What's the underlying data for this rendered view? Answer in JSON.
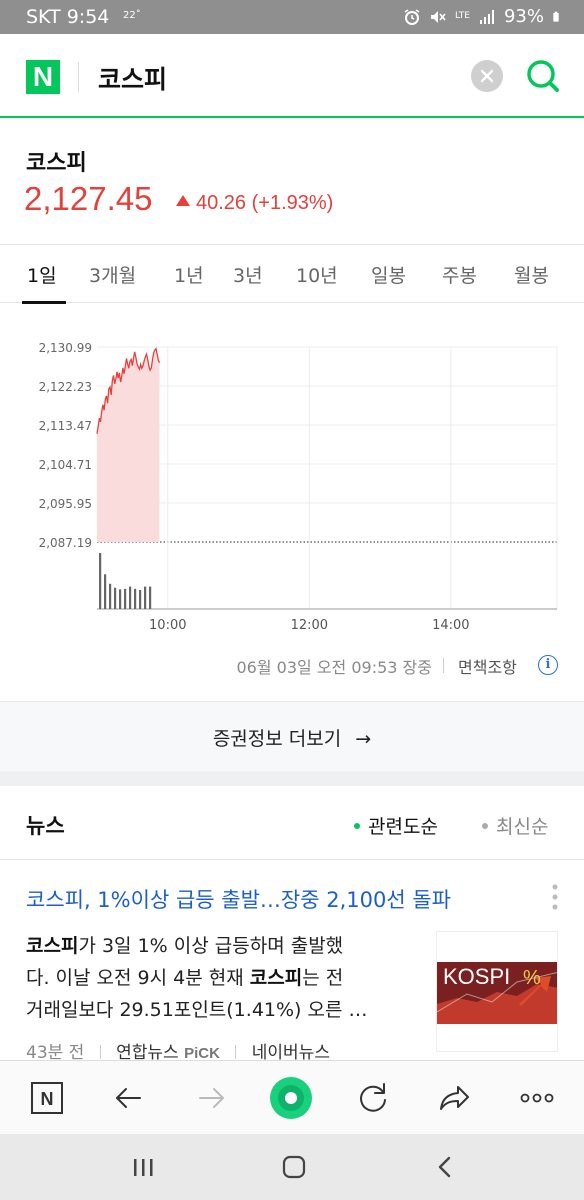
{
  "status_bar": {
    "carrier": "SKT",
    "time": "9:54",
    "temperature": "22˚",
    "network": "LTE",
    "battery": "93%"
  },
  "header": {
    "logo_letter": "N",
    "query": "코스피",
    "clear_icon": "close-icon",
    "search_icon": "search-icon",
    "accent_color": "#03c75a"
  },
  "stock": {
    "name": "코스피",
    "price": "2,127.45",
    "change": "40.26 (+1.93%)",
    "direction": "up",
    "up_color": "#e5413b"
  },
  "tabs": [
    {
      "label": "1일",
      "active": true
    },
    {
      "label": "3개월",
      "active": false
    },
    {
      "label": "1년",
      "active": false
    },
    {
      "label": "3년",
      "active": false
    },
    {
      "label": "10년",
      "active": false
    },
    {
      "label": "일봉",
      "active": false
    },
    {
      "label": "주봉",
      "active": false
    },
    {
      "label": "월봉",
      "active": false
    }
  ],
  "chart_data": {
    "type": "area",
    "y_ticks": [
      "2,130.99",
      "2,122.23",
      "2,113.47",
      "2,104.71",
      "2,095.95",
      "2,087.19"
    ],
    "ylim": [
      2087.19,
      2130.99
    ],
    "x_ticks": [
      "10:00",
      "12:00",
      "14:00"
    ],
    "x_range_minutes": [
      540,
      930
    ],
    "baseline": 2087.19,
    "series": [
      {
        "x": [
          540,
          541,
          542,
          543,
          544,
          545,
          546,
          547,
          548,
          549,
          550,
          551,
          552,
          553,
          554,
          555,
          556,
          557,
          558,
          559,
          560,
          561,
          562,
          563,
          564,
          565,
          566,
          567,
          568,
          569,
          570,
          571,
          572,
          573,
          574,
          575,
          576,
          577,
          578,
          579,
          580,
          581,
          582,
          583,
          584,
          585,
          586,
          587,
          588,
          589,
          590,
          591,
          592,
          593
        ],
        "values": [
          2111.5,
          2113.2,
          2115.0,
          2114.2,
          2116.5,
          2118.0,
          2116.8,
          2119.2,
          2120.0,
          2118.4,
          2121.6,
          2122.0,
          2120.2,
          2123.4,
          2124.6,
          2122.7,
          2123.9,
          2125.4,
          2124.0,
          2125.2,
          2123.1,
          2124.5,
          2126.3,
          2125.0,
          2126.6,
          2128.4,
          2127.1,
          2126.2,
          2127.8,
          2128.2,
          2126.8,
          2128.6,
          2129.9,
          2128.6,
          2127.2,
          2126.5,
          2126.0,
          2127.1,
          2126.2,
          2126.8,
          2127.9,
          2128.8,
          2129.4,
          2128.2,
          2126.6,
          2125.8,
          2126.3,
          2128.0,
          2129.6,
          2130.3,
          2130.6,
          2129.3,
          2128.1,
          2127.45
        ]
      }
    ],
    "volume_bars": [
      1.0,
      0.62,
      0.45,
      0.38,
      0.35,
      0.36,
      0.4,
      0.36,
      0.34,
      0.4,
      0.4
    ],
    "colors": {
      "line": "#e5413b",
      "fill": "#fbdcdd",
      "grid": "#ececec"
    },
    "grid": true
  },
  "chart_footer": {
    "timestamp": "06월 03일 오전 09:53 장중",
    "disclaimer": "면책조항",
    "info_icon": "info-icon"
  },
  "more": {
    "label": "증권정보 더보기",
    "arrow": "→"
  },
  "news": {
    "title": "뉴스",
    "sort_options": [
      {
        "label": "관련도순",
        "active": true,
        "dot_color": "#03c75a"
      },
      {
        "label": "최신순",
        "active": false,
        "dot_color": "#aaaaaa"
      }
    ],
    "article": {
      "headline": "코스피, 1%이상 급등 출발…장중 2,100선 돌파",
      "body_line1_bold": "코스피",
      "body_line1_rest": "가 3일 1% 이상 급등하며 출발했",
      "body_line2_start": "다. 이날 오전 9시 4분 현재 ",
      "body_line2_bold": "코스피",
      "body_line2_rest": "는 전",
      "body_line3": "거래일보다 29.51포인트(1.41%) 오른 …",
      "thumb_text": "KOSPI",
      "thumb_symbol": "%",
      "time_ago": "43분 전",
      "source": "연합뉴스",
      "pick": "PiCK",
      "portal": "네이버뉴스"
    }
  },
  "toolbar": {
    "home_letter": "N",
    "icons": [
      "naver-home-icon",
      "back-icon",
      "forward-icon",
      "green-dot-icon",
      "refresh-icon",
      "share-icon",
      "more-icon"
    ]
  },
  "system_nav": {
    "icons": [
      "recent-apps-icon",
      "home-icon",
      "back-icon"
    ]
  }
}
